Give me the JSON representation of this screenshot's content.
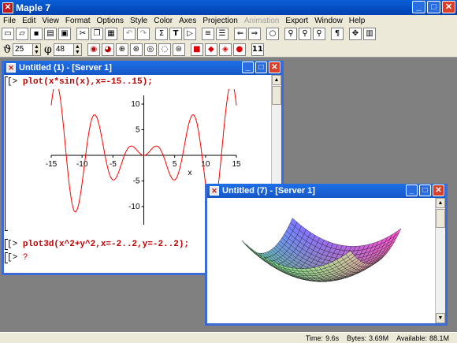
{
  "app": {
    "title": "Maple 7"
  },
  "menu": [
    "File",
    "Edit",
    "View",
    "Format",
    "Options",
    "Style",
    "Color",
    "Axes",
    "Projection",
    "Animation",
    "Export",
    "Window",
    "Help"
  ],
  "menu_disabled": [
    "Animation"
  ],
  "toolbar": {
    "theta_glyph": "ϑ",
    "theta_value": "25",
    "phi_glyph": "φ",
    "phi_value": "48",
    "sigma": "Σ",
    "T": "T",
    "play": "▷",
    "para": "¶",
    "num11": "11"
  },
  "worksheet1": {
    "title": "Untitled (1) - [Server 1]",
    "prompt": "[>",
    "line1": "plot(x*sin(x),x=-15..15);",
    "line2": "plot3d(x^2+y^2,x=-2..2,y=-2..2);",
    "line3": "?",
    "xlabel": "x",
    "xticks": [
      "-15",
      "-10",
      "-5",
      "5",
      "10",
      "15"
    ],
    "yticks": [
      "10",
      "5",
      "-5",
      "-10"
    ],
    "curve_color": "#ff0000"
  },
  "worksheet2": {
    "title": "Untitled (7) - [Server 1]"
  },
  "chart_data": {
    "type": "line",
    "function": "x*sin(x)",
    "xlim": [
      -15,
      15
    ],
    "xlabel": "x",
    "x_ticks": [
      -15,
      -10,
      -5,
      5,
      10,
      15
    ],
    "y_ticks": [
      10,
      5,
      -5,
      -10
    ],
    "series": [
      {
        "values_fn": "x*sin(x)",
        "color": "#ff0000"
      }
    ]
  },
  "status": {
    "time_label": "Time:",
    "time": "9.6s",
    "bytes_label": "Bytes:",
    "bytes": "3.69M",
    "avail_label": "Available:",
    "avail": "88.1M"
  }
}
